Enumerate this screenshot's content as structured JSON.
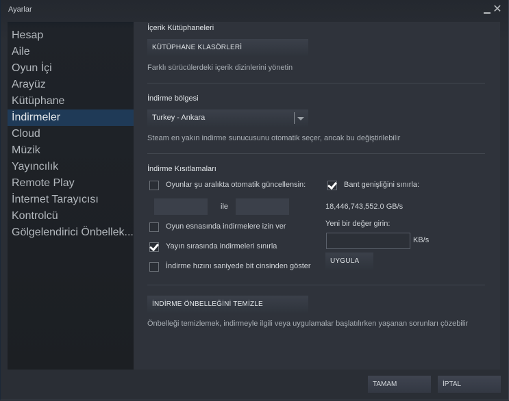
{
  "window": {
    "title": "Ayarlar",
    "minimize_icon": "minimize-icon",
    "close_icon": "close-icon"
  },
  "sidebar": {
    "items": [
      {
        "label": "Hesap",
        "active": false
      },
      {
        "label": "Aile",
        "active": false
      },
      {
        "label": "Oyun İçi",
        "active": false
      },
      {
        "label": "Arayüz",
        "active": false
      },
      {
        "label": "Kütüphane",
        "active": false
      },
      {
        "label": "İndirmeler",
        "active": true
      },
      {
        "label": "Cloud",
        "active": false
      },
      {
        "label": "Müzik",
        "active": false
      },
      {
        "label": "Yayıncılık",
        "active": false
      },
      {
        "label": "Remote Play",
        "active": false
      },
      {
        "label": "İnternet Tarayıcısı",
        "active": false
      },
      {
        "label": "Kontrolcü",
        "active": false
      },
      {
        "label": "Gölgelendirici Önbellek..."
      }
    ]
  },
  "content_libraries": {
    "title": "İçerik Kütüphaneleri",
    "button": "KÜTÜPHANE KLASÖRLERİ",
    "description": "Farklı sürücülerdeki içerik dizinlerini yönetin"
  },
  "download_region": {
    "title": "İndirme bölgesi",
    "selected": "Turkey - Ankara",
    "description": "Steam en yakın indirme sunucusunu otomatik seçer, ancak bu değiştirilebilir"
  },
  "download_restrictions": {
    "title": "İndirme Kısıtlamaları",
    "auto_update": {
      "label": "Oyunlar şu aralıkta otomatik güncellensin:",
      "checked": false
    },
    "range_from": "",
    "range_separator": "ile",
    "range_to": "",
    "allow_during_gameplay": {
      "label": "Oyun esnasında indirmelere izin ver",
      "checked": false
    },
    "throttle_while_streaming": {
      "label": "Yayın sırasında indirmeleri sınırla",
      "checked": true
    },
    "show_bits": {
      "label": "İndirme hızını saniyede bit cinsinden göster",
      "checked": false
    },
    "limit_bandwidth": {
      "label": "Bant genişliğini sınırla:",
      "checked": true
    },
    "current_limit": "18,446,743,552.0 GB/s",
    "new_value_label": "Yeni bir değer girin:",
    "new_value": "",
    "unit": "KB/s",
    "apply_button": "UYGULA"
  },
  "cache": {
    "button": "İNDİRME ÖNBELLEĞİNİ TEMİZLE",
    "description": "Önbelleği temizlemek, indirmeyle ilgili veya uygulamalar başlatılırken yaşanan sorunları çözebilir"
  },
  "footer": {
    "ok": "TAMAM",
    "cancel": "İPTAL"
  }
}
